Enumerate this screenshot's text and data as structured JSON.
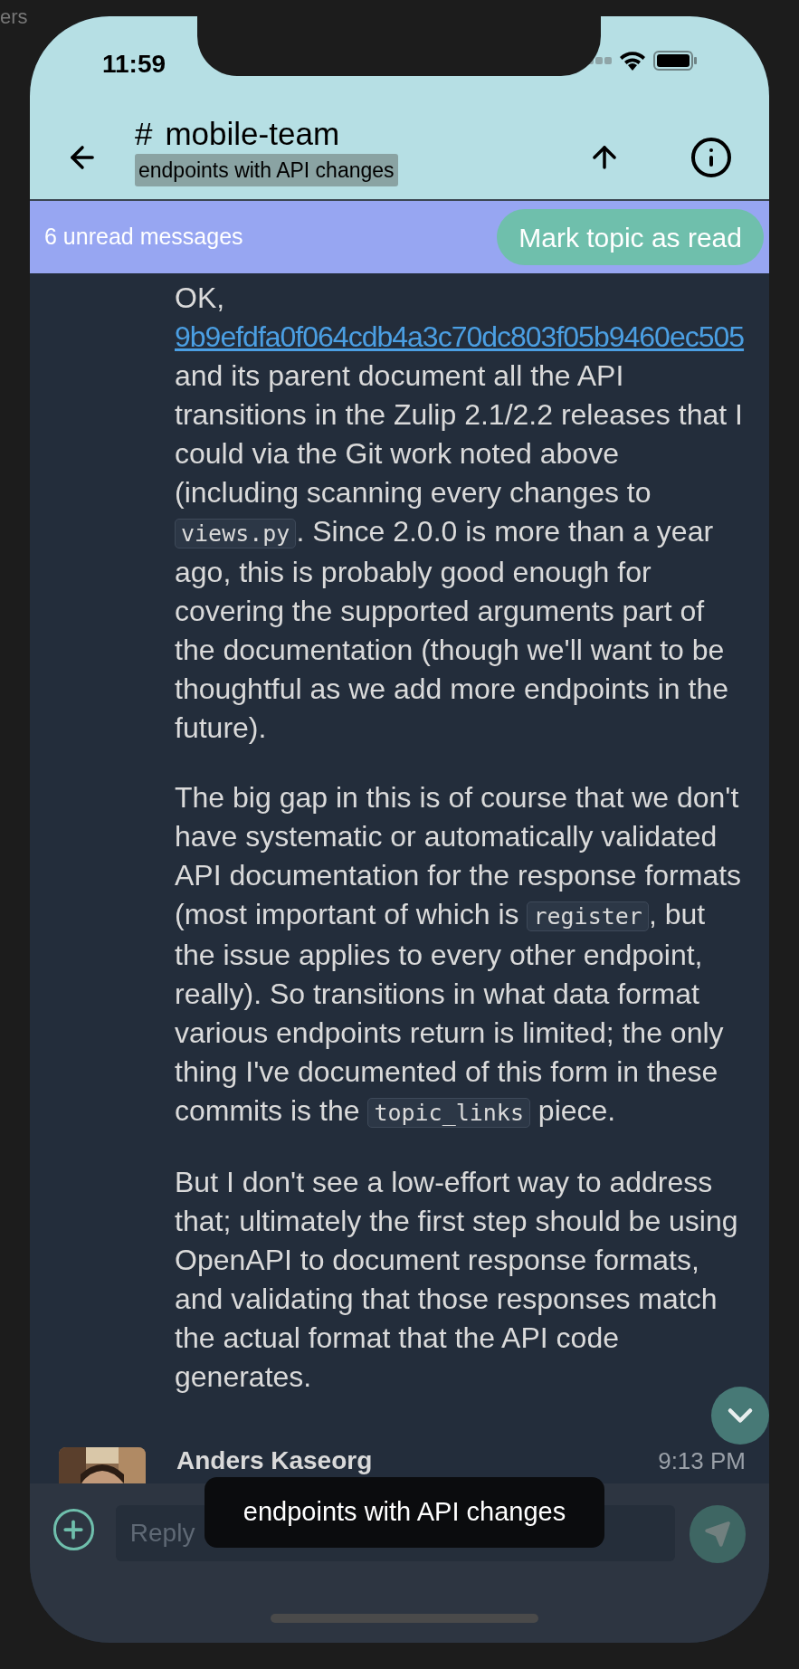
{
  "background_text": "ers",
  "status_bar": {
    "time": "11:59"
  },
  "header": {
    "stream_icon": "#",
    "stream": "mobile-team",
    "topic": "endpoints with API changes"
  },
  "unread_banner": {
    "text": "6 unread messages",
    "button": "Mark topic as read"
  },
  "message": {
    "paragraphs": [
      [
        {
          "kind": "text",
          "text": "OK, "
        },
        {
          "kind": "link",
          "text": "9b9efdfa0f064cdb4a3c70dc803f05b9460ec505"
        },
        {
          "kind": "text",
          "text": " and its parent document all the API transitions in the Zulip 2.1/2.2 releases that I could via the Git work noted above (including scanning every changes to "
        },
        {
          "kind": "code",
          "text": "views.py"
        },
        {
          "kind": "text",
          "text": ". Since 2.0.0 is more than a year ago, this is probably good enough for covering the supported arguments part of the documentation (though we'll want to be thoughtful as we add more endpoints in the future)."
        }
      ],
      [
        {
          "kind": "text",
          "text": "The big gap in this is of course that we don't have systematic or automatically validated API documentation for the response formats (most important of which is "
        },
        {
          "kind": "code",
          "text": "register"
        },
        {
          "kind": "text",
          "text": ", but the issue applies to every other endpoint, really). So transitions in what data format various endpoints return is limited; the only thing I've documented of this form in these commits is the "
        },
        {
          "kind": "code",
          "text": "topic_links"
        },
        {
          "kind": "text",
          "text": " piece."
        }
      ],
      [
        {
          "kind": "text",
          "text": "But I don't see a low-effort way to address that; ultimately the first step should be using OpenAPI to document response formats, and validating that those responses match the actual format that the API code generates."
        }
      ]
    ]
  },
  "next_message": {
    "sender": "Anders Kaseorg",
    "time": "9:13 PM"
  },
  "composer": {
    "placeholder": "Reply"
  },
  "tooltip": "endpoints with API changes"
}
